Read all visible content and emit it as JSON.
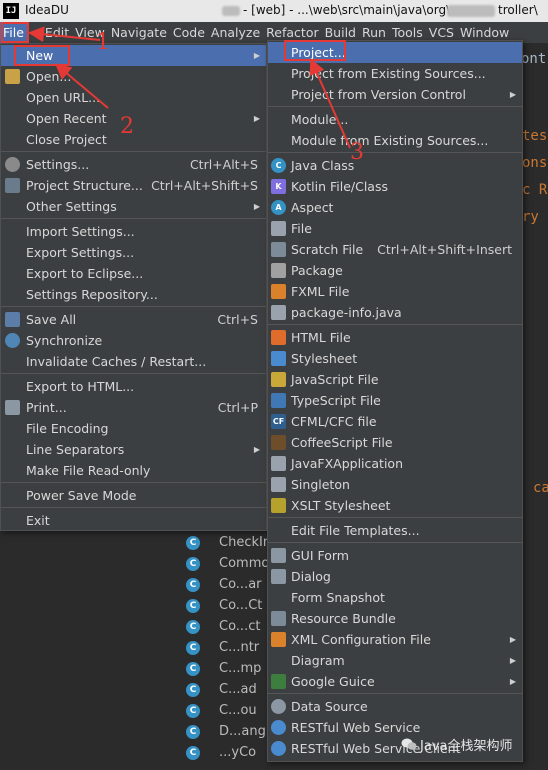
{
  "window": {
    "app_name": "IdeaDU",
    "title": "- [web] - ...\\web\\src\\main\\java\\org\\",
    "title_tail": "troller\\"
  },
  "menubar": [
    "File",
    "Edit",
    "View",
    "Navigate",
    "Code",
    "Analyze",
    "Refactor",
    "Build",
    "Run",
    "Tools",
    "VCS",
    "Window"
  ],
  "file_menu": {
    "new": "New",
    "open": "Open...",
    "open_url": "Open URL...",
    "open_recent": "Open Recent",
    "close_project": "Close Project",
    "settings": {
      "label": "Settings...",
      "shortcut": "Ctrl+Alt+S"
    },
    "project_structure": {
      "label": "Project Structure...",
      "shortcut": "Ctrl+Alt+Shift+S"
    },
    "other_settings": "Other Settings",
    "import_settings": "Import Settings...",
    "export_settings": "Export Settings...",
    "export_eclipse": "Export to Eclipse...",
    "settings_repository": "Settings Repository...",
    "save_all": {
      "label": "Save All",
      "shortcut": "Ctrl+S"
    },
    "synchronize": "Synchronize",
    "invalidate": "Invalidate Caches / Restart...",
    "export_html": "Export to HTML...",
    "print": {
      "label": "Print...",
      "shortcut": "Ctrl+P"
    },
    "file_encoding": "File Encoding",
    "line_separators": "Line Separators",
    "make_read_only": "Make File Read-only",
    "power_save": "Power Save Mode",
    "exit": "Exit"
  },
  "new_menu": {
    "project": "Project...",
    "project_existing": "Project from Existing Sources...",
    "project_vcs": "Project from Version Control",
    "module": "Module...",
    "module_existing": "Module from Existing Sources...",
    "java_class": "Java Class",
    "kotlin": "Kotlin File/Class",
    "aspect": "Aspect",
    "file": "File",
    "scratch": {
      "label": "Scratch File",
      "shortcut": "Ctrl+Alt+Shift+Insert"
    },
    "package": "Package",
    "fxml": "FXML File",
    "package_info": "package-info.java",
    "html": "HTML File",
    "stylesheet": "Stylesheet",
    "javascript": "JavaScript File",
    "typescript": "TypeScript File",
    "cfml": "CFML/CFC file",
    "coffeescript": "CoffeeScript File",
    "javafx": "JavaFXApplication",
    "singleton": "Singleton",
    "xslt": "XSLT Stylesheet",
    "edit_templates": "Edit File Templates...",
    "gui_form": "GUI Form",
    "dialog": "Dialog",
    "form_snapshot": "Form Snapshot",
    "resource_bundle": "Resource Bundle",
    "xml_config": "XML Configuration File",
    "diagram": "Diagram",
    "google_guice": "Google Guice",
    "data_source": "Data Source",
    "restful_ws": "RESTful Web Service",
    "restful_ws_client": "RESTful Web Service Client"
  },
  "editor_fragments": [
    "ontr",
    "test",
    "onst",
    "c R",
    "ry",
    "ca"
  ],
  "tree_items": [
    "CheckIn",
    "Commo",
    "Co...ar",
    "Co...Ct",
    "Co...ct",
    "C...ntr",
    "C...mp",
    "C...ad",
    "C...ou",
    "D...ang",
    "...yCo"
  ],
  "annotations": [
    "1",
    "2",
    "3"
  ],
  "watermark": "Java全栈架构师",
  "colors": {
    "highlight": "#4b6eaf",
    "annotation": "#e53935",
    "menu_bg": "#3c3f41"
  }
}
